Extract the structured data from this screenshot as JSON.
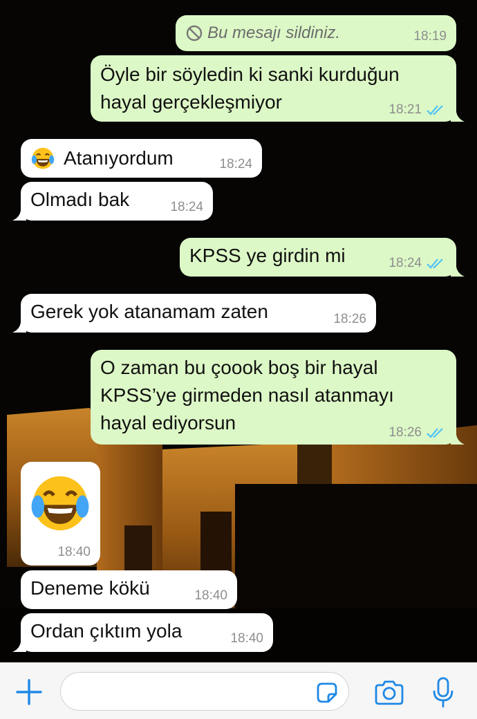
{
  "colors": {
    "outgoing_bubble": "#dcf8c6",
    "incoming_bubble": "#ffffff",
    "read_ticks": "#4fc3f7",
    "accent": "#1e88e5"
  },
  "messages": [
    {
      "id": "m1",
      "direction": "out",
      "deleted": true,
      "text": "Bu mesajı sildiniz.",
      "time": "18:19"
    },
    {
      "id": "m2",
      "direction": "out",
      "lines": [
        "Öyle bir söyledin ki sanki kurduğun",
        "hayal gerçekleşmiyor"
      ],
      "time": "18:21",
      "read": true
    },
    {
      "id": "m3",
      "direction": "in",
      "emoji": "face-with-tears-of-joy",
      "text": "Atanıyordum",
      "time": "18:24"
    },
    {
      "id": "m4",
      "direction": "in",
      "text": "Olmadı bak",
      "time": "18:24"
    },
    {
      "id": "m5",
      "direction": "out",
      "text": "KPSS ye girdin mi",
      "time": "18:24",
      "read": true
    },
    {
      "id": "m6",
      "direction": "in",
      "text": "Gerek yok atanamam zaten",
      "time": "18:26"
    },
    {
      "id": "m7",
      "direction": "out",
      "lines": [
        "O zaman bu çoook boş bir hayal",
        "KPSS’ye girmeden nasıl atanmayı",
        "hayal ediyorsun"
      ],
      "time": "18:26",
      "read": true
    },
    {
      "id": "m8",
      "direction": "in",
      "emoji": "face-with-tears-of-joy",
      "emoji_only": true,
      "time": "18:40"
    },
    {
      "id": "m9",
      "direction": "in",
      "text": "Deneme kökü",
      "time": "18:40"
    },
    {
      "id": "m10",
      "direction": "in",
      "text": "Ordan çıktım yola",
      "time": "18:40"
    }
  ],
  "input_bar": {
    "placeholder": "",
    "icons": [
      "plus-icon",
      "sticker-icon",
      "camera-icon",
      "microphone-icon"
    ]
  }
}
